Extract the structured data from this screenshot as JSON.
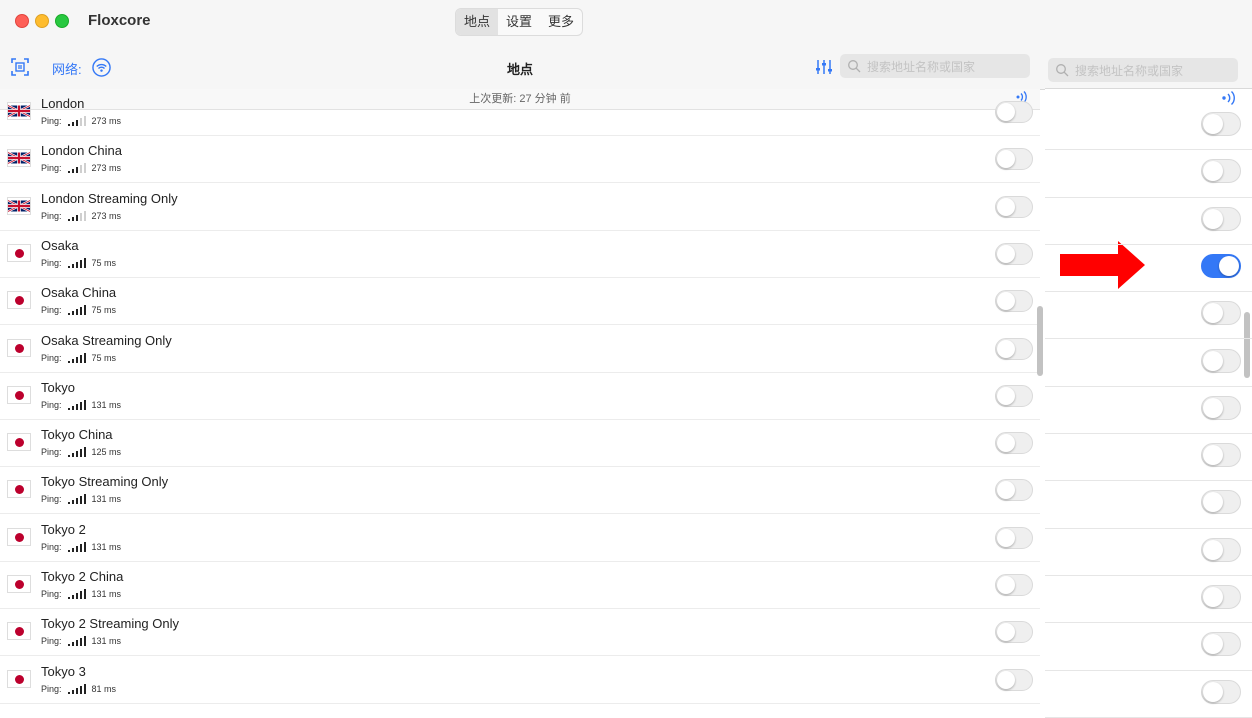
{
  "window": {
    "title": "Floxcore"
  },
  "tabs": [
    {
      "label": "地点",
      "active": true
    },
    {
      "label": "设置",
      "active": false
    },
    {
      "label": "更多",
      "active": false
    }
  ],
  "toolbar": {
    "network_label": "网络:",
    "page_title": "地点",
    "search_placeholder": "搜索地址名称或国家",
    "icons": [
      "scan-icon",
      "wifi-icon",
      "filter-icon",
      "search-icon"
    ]
  },
  "status": {
    "last_updated": "上次更新:  27 分钟 前"
  },
  "locations": [
    {
      "name": "London",
      "flag": "uk",
      "ping_label": "Ping:",
      "ping": "273 ms",
      "bars": 3,
      "enabled": false
    },
    {
      "name": "London China",
      "flag": "uk",
      "ping_label": "Ping:",
      "ping": "273 ms",
      "bars": 3,
      "enabled": false
    },
    {
      "name": "London Streaming Only",
      "flag": "uk",
      "ping_label": "Ping:",
      "ping": "273 ms",
      "bars": 3,
      "enabled": false
    },
    {
      "name": "Osaka",
      "flag": "jp",
      "ping_label": "Ping:",
      "ping": "75 ms",
      "bars": 5,
      "enabled": false
    },
    {
      "name": "Osaka China",
      "flag": "jp",
      "ping_label": "Ping:",
      "ping": "75 ms",
      "bars": 5,
      "enabled": false
    },
    {
      "name": "Osaka Streaming Only",
      "flag": "jp",
      "ping_label": "Ping:",
      "ping": "75 ms",
      "bars": 5,
      "enabled": false
    },
    {
      "name": "Tokyo",
      "flag": "jp",
      "ping_label": "Ping:",
      "ping": "131 ms",
      "bars": 5,
      "enabled": false
    },
    {
      "name": "Tokyo China",
      "flag": "jp",
      "ping_label": "Ping:",
      "ping": "125 ms",
      "bars": 5,
      "enabled": false
    },
    {
      "name": "Tokyo Streaming Only",
      "flag": "jp",
      "ping_label": "Ping:",
      "ping": "131 ms",
      "bars": 5,
      "enabled": false
    },
    {
      "name": "Tokyo 2",
      "flag": "jp",
      "ping_label": "Ping:",
      "ping": "131 ms",
      "bars": 5,
      "enabled": false
    },
    {
      "name": "Tokyo 2 China",
      "flag": "jp",
      "ping_label": "Ping:",
      "ping": "131 ms",
      "bars": 5,
      "enabled": false
    },
    {
      "name": "Tokyo 2 Streaming Only",
      "flag": "jp",
      "ping_label": "Ping:",
      "ping": "131 ms",
      "bars": 5,
      "enabled": false
    },
    {
      "name": "Tokyo 3",
      "flag": "jp",
      "ping_label": "Ping:",
      "ping": "81 ms",
      "bars": 5,
      "enabled": false
    }
  ],
  "zoom_panel": {
    "search_placeholder": "搜索地址名称或国家",
    "toggles_enabled": [
      false,
      false,
      false,
      true,
      false,
      false,
      false,
      false,
      false,
      false,
      false,
      false,
      false
    ],
    "annotation": "red-arrow-pointing-at-enabled-toggle",
    "accent_color": "#3478f6",
    "arrow_color": "#ff0000"
  }
}
